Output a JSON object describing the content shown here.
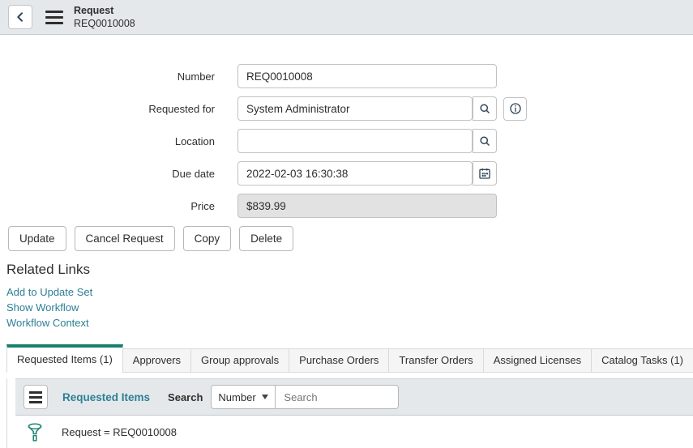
{
  "header": {
    "title": "Request",
    "subtitle": "REQ0010008"
  },
  "form": {
    "fields": [
      {
        "label": "Number",
        "value": "REQ0010008"
      },
      {
        "label": "Requested for",
        "value": "System Administrator"
      },
      {
        "label": "Location",
        "value": ""
      },
      {
        "label": "Due date",
        "value": "2022-02-03 16:30:38"
      },
      {
        "label": "Price",
        "value": "$839.99"
      }
    ]
  },
  "actions": {
    "buttons": [
      "Update",
      "Cancel Request",
      "Copy",
      "Delete"
    ]
  },
  "related_links": {
    "title": "Related Links",
    "links": [
      "Add to Update Set",
      "Show Workflow",
      "Workflow Context"
    ]
  },
  "tabs": [
    {
      "label": "Requested Items (1)",
      "active": true
    },
    {
      "label": "Approvers",
      "active": false
    },
    {
      "label": "Group approvals",
      "active": false
    },
    {
      "label": "Purchase Orders",
      "active": false
    },
    {
      "label": "Transfer Orders",
      "active": false
    },
    {
      "label": "Assigned Licenses",
      "active": false
    },
    {
      "label": "Catalog Tasks (1)",
      "active": false
    }
  ],
  "list": {
    "title": "Requested Items",
    "search_label": "Search",
    "search_field": "Number",
    "search_placeholder": "Search",
    "filter_text": "Request = REQ0010008"
  },
  "icons": [
    "back-chevron",
    "menu",
    "search-magnifier",
    "info-circle",
    "calendar",
    "caret-down",
    "filter-funnel"
  ],
  "colors": {
    "header_bg": "#e5e8ea",
    "accent_green": "#17816d",
    "link_teal": "#2c7f95",
    "readonly_bg": "#e2e2e2",
    "icon_navy": "#2e4356"
  }
}
